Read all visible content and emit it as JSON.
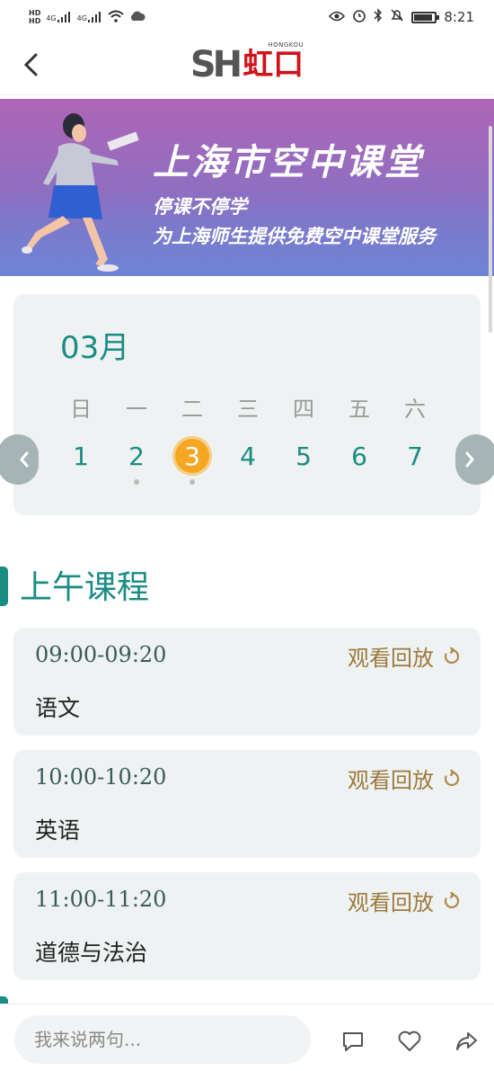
{
  "status_bar": {
    "hd1": "HD",
    "hd2": "HD",
    "signal1": "4G",
    "signal2": "4G",
    "time": "8:21"
  },
  "header": {
    "logo_sh": "SH",
    "logo_cn": "虹口",
    "logo_en": "HONGKOU"
  },
  "banner": {
    "title": "上海市空中课堂",
    "line1": "停课不停学",
    "line2": "为上海师生提供免费空中课堂服务"
  },
  "calendar": {
    "month": "03月",
    "weekdays": [
      "日",
      "一",
      "二",
      "三",
      "四",
      "五",
      "六"
    ],
    "days": [
      {
        "num": "1",
        "selected": false,
        "dot": false
      },
      {
        "num": "2",
        "selected": false,
        "dot": true
      },
      {
        "num": "3",
        "selected": true,
        "dot": true
      },
      {
        "num": "4",
        "selected": false,
        "dot": false
      },
      {
        "num": "5",
        "selected": false,
        "dot": false
      },
      {
        "num": "6",
        "selected": false,
        "dot": false
      },
      {
        "num": "7",
        "selected": false,
        "dot": false
      }
    ]
  },
  "section": {
    "title": "上午课程"
  },
  "courses": [
    {
      "time": "09:00-09:20",
      "replay": "观看回放",
      "subject": "语文"
    },
    {
      "time": "10:00-10:20",
      "replay": "观看回放",
      "subject": "英语"
    },
    {
      "time": "11:00-11:20",
      "replay": "观看回放",
      "subject": "道德与法治"
    }
  ],
  "bottom_bar": {
    "comment_placeholder": "我来说两句..."
  },
  "colors": {
    "accent": "#1a8c82",
    "selected_day": "#f5a623",
    "replay": "#9c7a3c",
    "card_bg": "#eff2f3"
  }
}
